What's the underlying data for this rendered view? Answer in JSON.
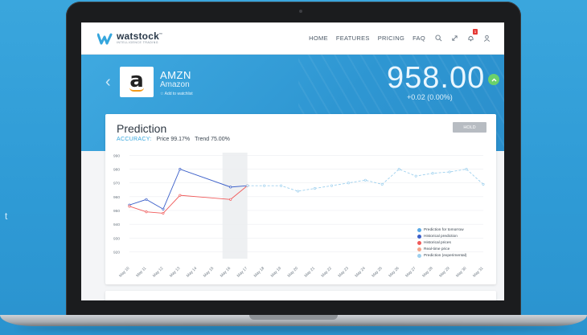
{
  "background": {
    "text": "t"
  },
  "nav": {
    "brand": "watstock",
    "brand_tm": "™",
    "tagline": "INTELLIGENCE TRADING",
    "links": [
      "HOME",
      "FEATURES",
      "PRICING",
      "FAQ"
    ],
    "notification_count": "1",
    "icons": [
      "search-icon",
      "expand-icon",
      "bell-icon",
      "user-icon"
    ]
  },
  "stock": {
    "symbol": "AMZN",
    "name": "Amazon",
    "watchlist_label": "Add to watchlist",
    "price": "958.00",
    "change": "+0.02 (0.00%)"
  },
  "prediction": {
    "title": "Prediction",
    "action": "HOLD",
    "accuracy_label": "ACCURACY:",
    "price_accuracy": "Price 99.17%",
    "trend_accuracy": "Trend 75.00%"
  },
  "colors": {
    "accent": "#35a6dd",
    "prediction_tomorrow": "#5aa9e6",
    "historical_prediction": "#3b5fc9",
    "historical_prices": "#f05a5a",
    "realtime_price": "#f3a58a",
    "prediction_experimental": "#9ed0ee"
  },
  "chart_data": {
    "type": "line",
    "categories": [
      "May 10",
      "May 11",
      "May 12",
      "May 13",
      "May 14",
      "May 15",
      "May 16",
      "May 17",
      "May 18",
      "May 19",
      "May 20",
      "May 21",
      "May 22",
      "May 23",
      "May 24",
      "May 25",
      "May 26",
      "May 27",
      "May 28",
      "May 29",
      "May 30",
      "May 31"
    ],
    "ylim": [
      915,
      992
    ],
    "yticks": [
      920,
      930,
      940,
      950,
      960,
      970,
      980,
      990
    ],
    "highlight_range": [
      "May 16",
      "May 17"
    ],
    "series": [
      {
        "name": "Historical prediction",
        "color": "#3b5fc9",
        "style": "solid",
        "points": [
          [
            "May 10",
            954
          ],
          [
            "May 11",
            958
          ],
          [
            "May 12",
            951
          ],
          [
            "May 13",
            980
          ],
          [
            "May 16",
            967
          ],
          [
            "May 17",
            968
          ]
        ]
      },
      {
        "name": "Historical prices",
        "color": "#f05a5a",
        "style": "solid",
        "points": [
          [
            "May 10",
            953
          ],
          [
            "May 11",
            949
          ],
          [
            "May 12",
            948
          ],
          [
            "May 13",
            961
          ],
          [
            "May 16",
            958
          ],
          [
            "May 17",
            968
          ]
        ]
      },
      {
        "name": "Prediction (experimental)",
        "color": "#9ed0ee",
        "style": "dashed",
        "points": [
          [
            "May 17",
            968
          ],
          [
            "May 18",
            968
          ],
          [
            "May 19",
            968
          ],
          [
            "May 20",
            964
          ],
          [
            "May 21",
            966
          ],
          [
            "May 22",
            968
          ],
          [
            "May 23",
            970
          ],
          [
            "May 24",
            972
          ],
          [
            "May 25",
            969
          ],
          [
            "May 26",
            980
          ],
          [
            "May 27",
            975
          ],
          [
            "May 28",
            977
          ],
          [
            "May 29",
            978
          ],
          [
            "May 30",
            980
          ],
          [
            "May 31",
            969
          ]
        ]
      }
    ],
    "legend": [
      "Prediction for tomorrow",
      "Historical prediction",
      "Historical prices",
      "Real-time price",
      "Prediction (experimental)"
    ],
    "legend_position": "bottom-right"
  }
}
